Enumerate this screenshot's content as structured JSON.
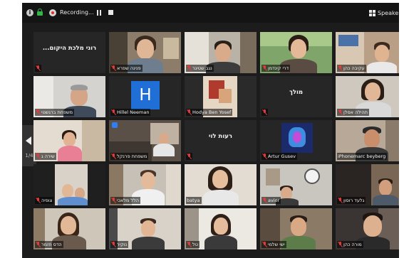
{
  "toolbar": {
    "recording_label": "Recording...",
    "speaker_view_label": "Speake"
  },
  "pager": {
    "page_indicator": "1/4"
  },
  "colors": {
    "window_bg": "#1c1c1c",
    "active_border": "#9fd64e",
    "mute_red": "#e23b3b",
    "lock_green": "#36b24a",
    "avatar_blue": "#1f6fd6"
  },
  "participants": [
    {
      "name": "...רוני מלכת היקום",
      "display": "name-only"
    },
    {
      "name": "פנינה שפרא",
      "display": "video"
    },
    {
      "name": "נגב שטיגר",
      "display": "video"
    },
    {
      "name": "דרי קינדמן",
      "display": "video"
    },
    {
      "name": "עקיבה כהן",
      "display": "video"
    },
    {
      "name": "משפחת ברגשטי",
      "display": "video"
    },
    {
      "name": "Hillel Neeman",
      "display": "avatar",
      "avatar_letter": "H"
    },
    {
      "name": "Hodya Ben Yosef",
      "display": "video"
    },
    {
      "name": "מולך",
      "display": "name-only"
    },
    {
      "name": "תהילה אסלן",
      "display": "video"
    },
    {
      "name": "שירה ג",
      "display": "video"
    },
    {
      "name": "משפחת פרנקל",
      "display": "video"
    },
    {
      "name": "רעות לוי",
      "display": "name-only"
    },
    {
      "name": "Artur Gusev",
      "display": "video"
    },
    {
      "name": "iPhonemarc beyberg",
      "display": "video",
      "active_speaker": true
    },
    {
      "name": "צופיה",
      "display": "video"
    },
    {
      "name": "הלל מלאכי",
      "display": "video"
    },
    {
      "name": "batya",
      "display": "video"
    },
    {
      "name": "avior",
      "display": "video"
    },
    {
      "name": "גלעד רוסון",
      "display": "video"
    },
    {
      "name": "הדס חזמר",
      "display": "video"
    },
    {
      "name": "נוקיר",
      "display": "video"
    },
    {
      "name": "טל",
      "display": "video"
    },
    {
      "name": "ישי שלמי",
      "display": "video"
    },
    {
      "name": "מורה כהן",
      "display": "video"
    }
  ]
}
